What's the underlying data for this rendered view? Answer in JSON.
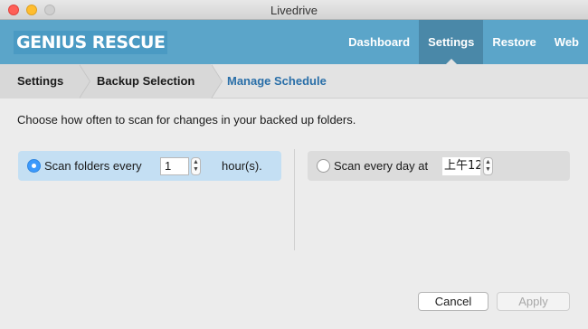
{
  "window": {
    "title": "Livedrive"
  },
  "header": {
    "logo_text": "GENIUS RESCUE",
    "nav": [
      {
        "label": "Dashboard",
        "active": false
      },
      {
        "label": "Settings",
        "active": true
      },
      {
        "label": "Restore",
        "active": false
      },
      {
        "label": "Web",
        "active": false
      }
    ]
  },
  "breadcrumb": [
    "Settings",
    "Backup Selection",
    "Manage Schedule"
  ],
  "schedule": {
    "instruction": "Choose how often to scan for changes in your backed up folders.",
    "option_interval": {
      "label": "Scan folders every",
      "value": "1",
      "unit": "hour(s).",
      "selected": true
    },
    "option_daily": {
      "label": "Scan every day at",
      "time_value": "上午12",
      "selected": false
    }
  },
  "footer": {
    "cancel_label": "Cancel",
    "apply_label": "Apply"
  },
  "colors": {
    "header": "#5ba5c9",
    "nav_active": "#4a88a8",
    "link_active": "#2a6fa8",
    "selected_option": "#c4dff3"
  }
}
